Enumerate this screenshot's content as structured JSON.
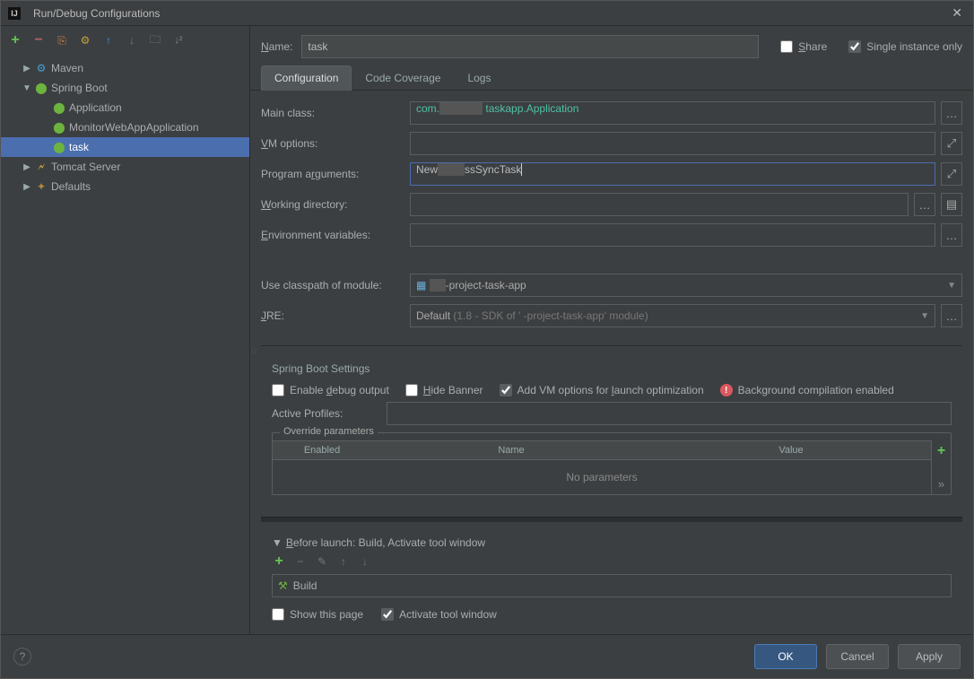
{
  "titlebar": {
    "title": "Run/Debug Configurations"
  },
  "tree": {
    "maven": "Maven",
    "springboot": "Spring Boot",
    "app": "Application",
    "monitor": "MonitorWebAppApplication",
    "task": "task",
    "tomcat": "Tomcat Server",
    "defaults": "Defaults"
  },
  "name": {
    "label_pre": "N",
    "label_rest": "ame:",
    "value": "task"
  },
  "share": {
    "label_pre": "S",
    "label_rest": "hare"
  },
  "single": {
    "label_text": "Single instance only"
  },
  "tabs": {
    "config": "Configuration",
    "coverage": "Code Coverage",
    "logs": "Logs"
  },
  "form": {
    "mainclass_label": "Main class:",
    "mainclass_pre": "com.",
    "mainclass_post": "taskapp.Application",
    "vmoptions_pre": "V",
    "vmoptions_rest": "M options:",
    "progargs_label": "Program arguments:",
    "progargs_value_pre": "New",
    "progargs_value_post": "ssSyncTask",
    "workdir_pre": "W",
    "workdir_rest": "orking directory:",
    "envvars_pre": "E",
    "envvars_rest": "nvironment variables:",
    "classpath_label": "Use classpath of module:",
    "classpath_value": "-project-task-app",
    "jre_pre": "J",
    "jre_rest": "RE:",
    "jre_default": "Default ",
    "jre_grey": "(1.8 - SDK of '        -project-task-app' module)"
  },
  "spring": {
    "title": "Spring Boot Settings",
    "debug_label": "Enable debug output",
    "hide_label": "Hide Banner",
    "addvm_label": "Add VM options for launch optimization",
    "bgcomp_label": "Background compilation enabled",
    "profiles_label": "Active Profiles:",
    "override_legend": "Override parameters",
    "col_enabled": "Enabled",
    "col_name": "Name",
    "col_value": "Value",
    "noparams": "No parameters"
  },
  "before": {
    "header": "Before launch: Build, Activate tool window",
    "build": "Build",
    "showpage_label": "Show this page",
    "activate_label": "Activate tool window"
  },
  "buttons": {
    "ok": "OK",
    "cancel": "Cancel",
    "apply": "Apply"
  }
}
